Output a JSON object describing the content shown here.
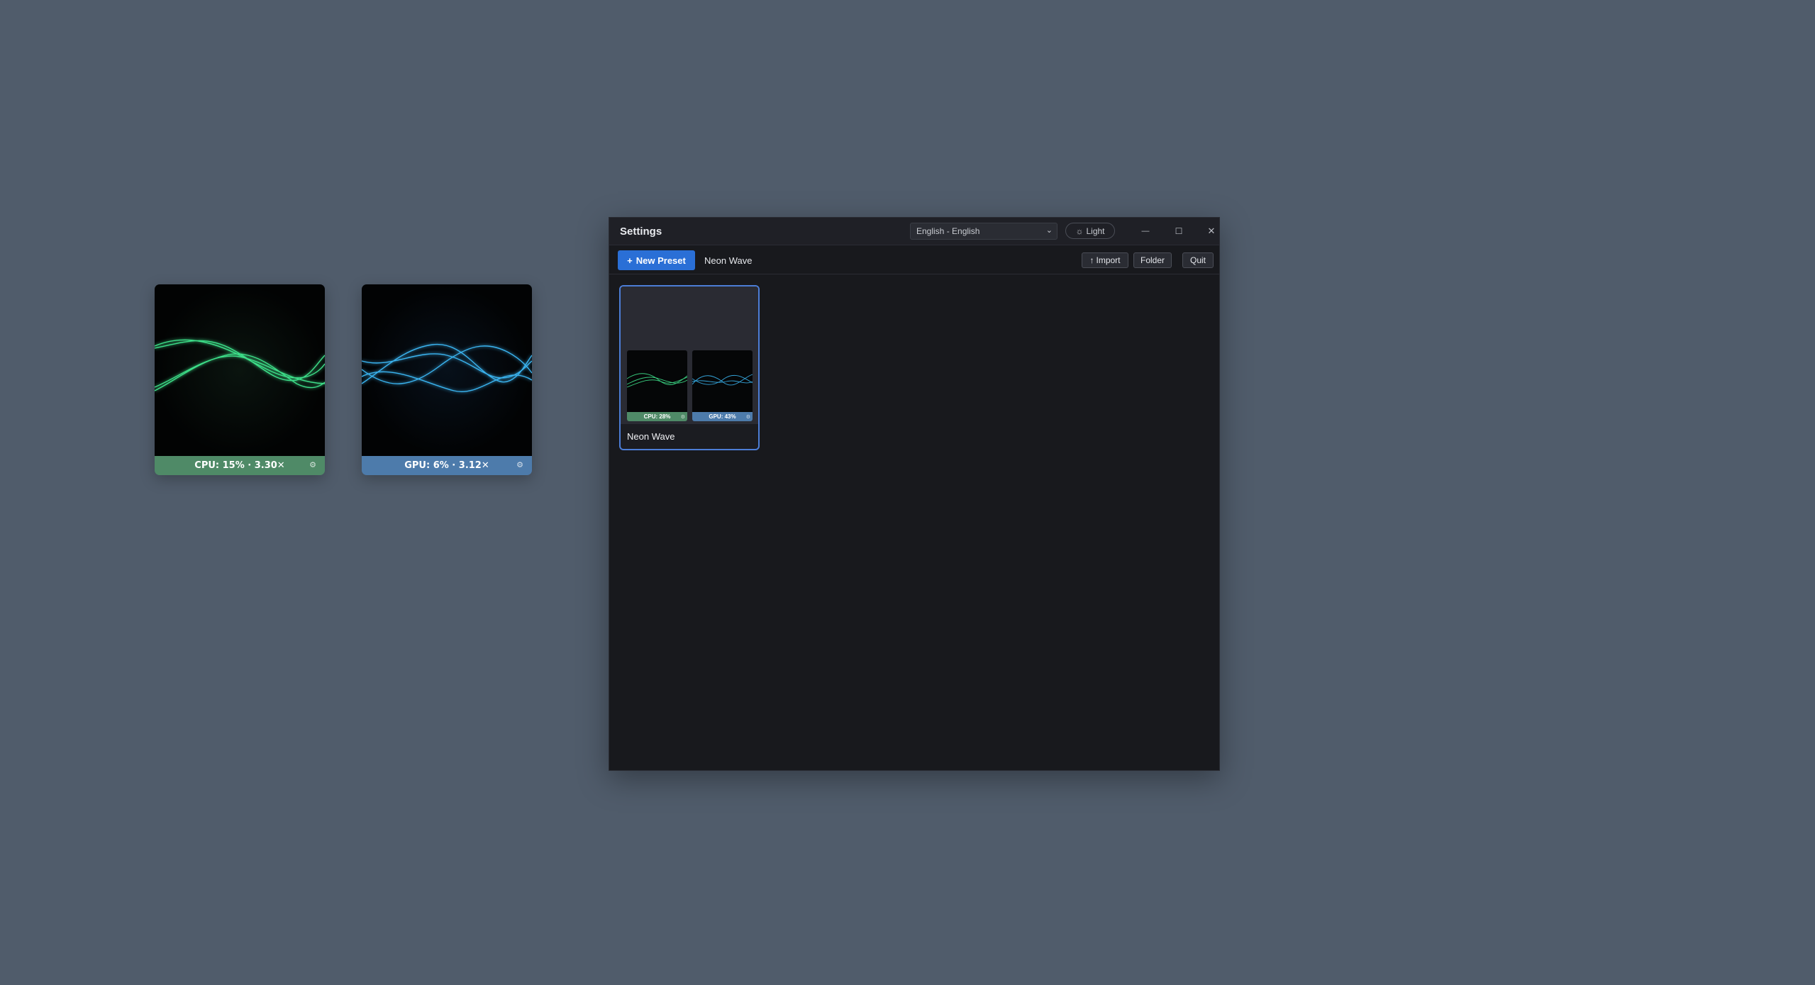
{
  "desktop": {
    "cpu_widget": {
      "label": "CPU: 15% · 3.30✕",
      "gear": "⚙",
      "color": "#4f8a67"
    },
    "gpu_widget": {
      "label": "GPU: 6% · 3.12✕",
      "gear": "⚙",
      "color": "#4d7bab"
    }
  },
  "window": {
    "title": "Settings",
    "language_select": {
      "value": "English - English",
      "chevron": "⌄"
    },
    "theme_button": {
      "icon": "☼",
      "label": "Light"
    },
    "controls": {
      "minimize": "—",
      "maximize": "☐",
      "close": "✕"
    }
  },
  "toolbar": {
    "new_preset": {
      "icon": "+",
      "label": "New Preset"
    },
    "current_preset": "Neon Wave",
    "import": {
      "icon": "↑",
      "label": "Import"
    },
    "folder_label": "Folder",
    "quit_label": "Quit"
  },
  "presets": [
    {
      "name": "Neon Wave",
      "cpu_preview": "CPU: 28%",
      "gpu_preview": "GPU: 43%",
      "gear": "⚙"
    }
  ],
  "colors": {
    "accent": "#2a6fd6",
    "card_border": "#4c7dd6",
    "cpu_wave": "#3ee08a",
    "gpu_wave": "#3ab4f0"
  }
}
